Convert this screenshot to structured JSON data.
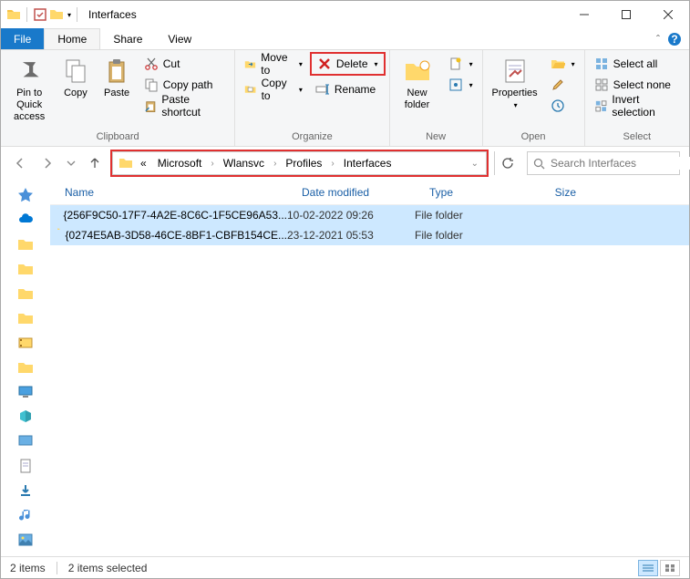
{
  "window": {
    "title": "Interfaces"
  },
  "tabs": {
    "file": "File",
    "home": "Home",
    "share": "Share",
    "view": "View"
  },
  "ribbon": {
    "clipboard": {
      "label": "Clipboard",
      "pin": "Pin to Quick access",
      "copy": "Copy",
      "paste": "Paste",
      "cut": "Cut",
      "copy_path": "Copy path",
      "paste_shortcut": "Paste shortcut"
    },
    "organize": {
      "label": "Organize",
      "move_to": "Move to",
      "copy_to": "Copy to",
      "delete": "Delete",
      "rename": "Rename"
    },
    "new": {
      "label": "New",
      "new_folder": "New folder"
    },
    "open": {
      "label": "Open",
      "properties": "Properties"
    },
    "select": {
      "label": "Select",
      "select_all": "Select all",
      "select_none": "Select none",
      "invert": "Invert selection"
    }
  },
  "breadcrumb": {
    "prefix": "«",
    "items": [
      "Microsoft",
      "Wlansvc",
      "Profiles",
      "Interfaces"
    ]
  },
  "search": {
    "placeholder": "Search Interfaces"
  },
  "columns": {
    "name": "Name",
    "date": "Date modified",
    "type": "Type",
    "size": "Size"
  },
  "rows": [
    {
      "name": "{256F9C50-17F7-4A2E-8C6C-1F5CE96A53...",
      "date": "10-02-2022 09:26",
      "type": "File folder"
    },
    {
      "name": "{0274E5AB-3D58-46CE-8BF1-CBFB154CE...",
      "date": "23-12-2021 05:53",
      "type": "File folder"
    }
  ],
  "status": {
    "items": "2 items",
    "selected": "2 items selected"
  }
}
